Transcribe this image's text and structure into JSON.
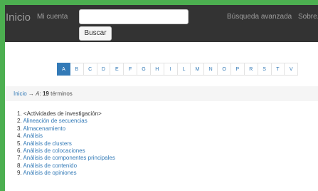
{
  "navbar": {
    "brand": "Inicio",
    "my_account": "Mi cuenta",
    "search_value": "",
    "search_button": "Buscar",
    "advanced_search": "Búsqueda avanzada",
    "about": "Sobre..."
  },
  "letters": [
    "A",
    "B",
    "C",
    "D",
    "E",
    "F",
    "G",
    "H",
    "I",
    "L",
    "M",
    "N",
    "O",
    "P",
    "R",
    "S",
    "T",
    "V"
  ],
  "active_letter": "A",
  "breadcrumb": {
    "home": "Inicio",
    "arrow": "→",
    "letter": "A",
    "colon": ":",
    "count": "19",
    "suffix": "términos"
  },
  "terms": [
    {
      "num": "1.",
      "label": "<Actividades de investigación>",
      "link": false
    },
    {
      "num": "2.",
      "label": "Alineación de secuencias",
      "link": true
    },
    {
      "num": "3.",
      "label": "Almacenamiento",
      "link": true
    },
    {
      "num": "4.",
      "label": "Análisis",
      "link": true
    },
    {
      "num": "5.",
      "label": "Análisis de clusters",
      "link": true
    },
    {
      "num": "6.",
      "label": "Análisis de colocaciones",
      "link": true
    },
    {
      "num": "7.",
      "label": "Análisis de componentes principales",
      "link": true
    },
    {
      "num": "8.",
      "label": "Análisis de contenido",
      "link": true
    },
    {
      "num": "9.",
      "label": "Análisis de opiniones",
      "link": true
    }
  ],
  "colors": {
    "frame": "#4CAF50",
    "navbar_bg": "#333333",
    "link": "#337ab7",
    "active_letter_bg": "#337ab7",
    "breadcrumb_bg": "#f5f5f5"
  }
}
